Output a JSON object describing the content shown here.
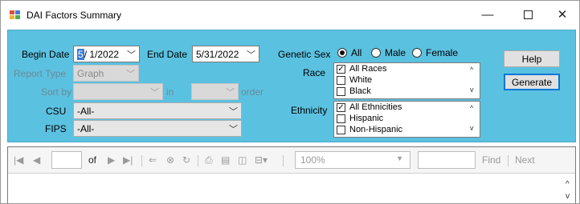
{
  "window": {
    "title": "DAI Factors Summary",
    "minimize_glyph": "—",
    "close_glyph": "✕"
  },
  "filters": {
    "begin_date": {
      "label": "Begin Date",
      "month": "5",
      "rest": "/ 1/2022"
    },
    "end_date": {
      "label": "End Date",
      "value": "5/31/2022"
    },
    "report_type": {
      "label": "Report Type",
      "value": "Graph"
    },
    "sort_by": {
      "label": "Sort by",
      "value": "",
      "in_label": "in",
      "order_value": "",
      "order_label": "order"
    },
    "csu": {
      "label": "CSU",
      "value": "-All-"
    },
    "fips": {
      "label": "FIPS",
      "value": "-All-"
    },
    "genetic_sex": {
      "label": "Genetic Sex",
      "options": [
        {
          "label": "All",
          "selected": true
        },
        {
          "label": "Male",
          "selected": false
        },
        {
          "label": "Female",
          "selected": false
        }
      ]
    },
    "race": {
      "label": "Race",
      "items": [
        {
          "label": "All Races",
          "checked": true
        },
        {
          "label": "White",
          "checked": false
        },
        {
          "label": "Black",
          "checked": false
        }
      ]
    },
    "ethnicity": {
      "label": "Ethnicity",
      "items": [
        {
          "label": "All Ethnicities",
          "checked": true
        },
        {
          "label": "Hispanic",
          "checked": false
        },
        {
          "label": "Non-Hispanic",
          "checked": false
        }
      ]
    }
  },
  "buttons": {
    "help": "Help",
    "generate": "Generate"
  },
  "viewer": {
    "of_label": "of",
    "page_value": "",
    "zoom": "100%",
    "find_value": "",
    "find_label": "Find",
    "next_label": "Next"
  },
  "colors": {
    "panel": "#5bc1e0",
    "accent": "#0078d7",
    "date_highlight": "#3a7bd5"
  },
  "icons": [
    "app-icon",
    "first-page-icon",
    "prev-page-icon",
    "next-page-icon",
    "last-page-icon",
    "back-icon",
    "stop-icon",
    "refresh-icon",
    "print-icon",
    "print-layout-icon",
    "page-setup-icon",
    "export-icon"
  ]
}
